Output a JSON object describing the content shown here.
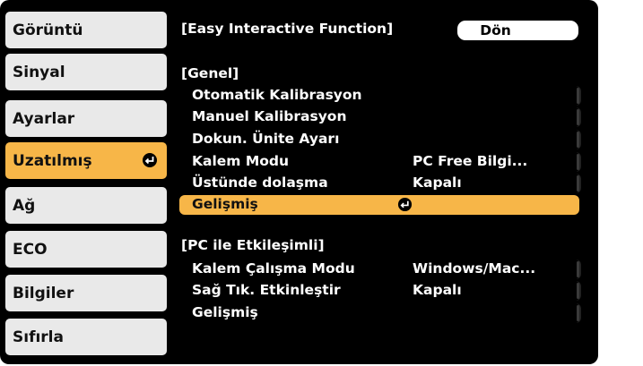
{
  "sidebar": {
    "items": [
      {
        "label": "Görüntü"
      },
      {
        "label": "Sinyal"
      },
      {
        "label": "Ayarlar"
      },
      {
        "label": "Uzatılmış"
      },
      {
        "label": "Ağ"
      },
      {
        "label": "ECO"
      },
      {
        "label": "Bilgiler"
      },
      {
        "label": "Sıfırla"
      }
    ],
    "active_index": 3
  },
  "header": {
    "title": "[Easy Interactive Function]",
    "back_label": "Dön"
  },
  "sections": [
    {
      "title": "[Genel]",
      "rows": [
        {
          "label": "Otomatik Kalibrasyon",
          "value": ""
        },
        {
          "label": "Manuel Kalibrasyon",
          "value": ""
        },
        {
          "label": "Dokun. Ünite Ayarı",
          "value": ""
        },
        {
          "label": "Kalem Modu",
          "value": "PC Free Bilgi..."
        },
        {
          "label": "Üstünde dolaşma",
          "value": "Kapalı"
        },
        {
          "label": "Gelişmiş",
          "value": ""
        }
      ]
    },
    {
      "title": "[PC ile Etkileşimli]",
      "rows": [
        {
          "label": "Kalem Çalışma Modu",
          "value": "Windows/Mac..."
        },
        {
          "label": "Sağ Tık. Etkinleştir",
          "value": "Kapalı"
        },
        {
          "label": "Gelişmiş",
          "value": ""
        }
      ]
    }
  ],
  "colors": {
    "accent": "#f7b648",
    "sidebar_bg": "#e9e9e9",
    "screen_bg": "#000000",
    "text": "#ffffff"
  },
  "icons": {
    "enter": "enter-arrow-icon"
  }
}
